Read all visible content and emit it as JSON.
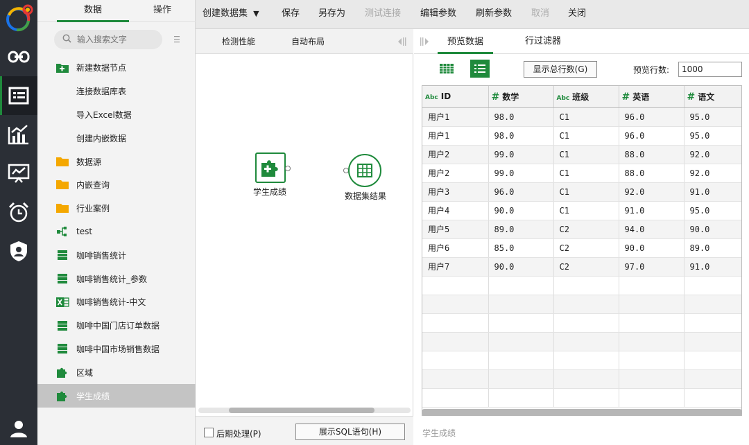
{
  "panel": {
    "tabs": [
      "数据",
      "操作"
    ],
    "search_placeholder": "输入搜索文字",
    "tree": [
      {
        "label": "新建数据节点",
        "icon": "new-folder-icon"
      },
      {
        "label": "连接数据库表",
        "icon": ""
      },
      {
        "label": "导入Excel数据",
        "icon": ""
      },
      {
        "label": "创建内嵌数据",
        "icon": ""
      },
      {
        "label": "数据源",
        "icon": "folder-icon"
      },
      {
        "label": "内嵌查询",
        "icon": "folder-icon"
      },
      {
        "label": "行业案例",
        "icon": "folder-icon"
      },
      {
        "label": "test",
        "icon": "flow-icon"
      },
      {
        "label": "咖啡销售统计",
        "icon": "table-icon"
      },
      {
        "label": "咖啡销售统计_参数",
        "icon": "table-icon"
      },
      {
        "label": "咖啡销售统计-中文",
        "icon": "excel-icon"
      },
      {
        "label": "咖啡中国门店订单数据",
        "icon": "table-icon"
      },
      {
        "label": "咖啡中国市场销售数据",
        "icon": "table-icon"
      },
      {
        "label": "区域",
        "icon": "puzzle-icon"
      },
      {
        "label": "学生成绩",
        "icon": "puzzle-icon",
        "selected": true
      }
    ]
  },
  "toolbar": {
    "create": "创建数据集",
    "save": "保存",
    "save_as": "另存为",
    "test_conn": "测试连接",
    "edit_params": "编辑参数",
    "refresh_params": "刷新参数",
    "cancel": "取消",
    "close": "关闭"
  },
  "canvas": {
    "detect": "检测性能",
    "auto_layout": "自动布局",
    "node_source": "学生成绩",
    "node_result": "数据集结果",
    "post_process": "后期处理(P)",
    "show_sql": "展示SQL语句(H)"
  },
  "preview": {
    "tab_preview": "预览数据",
    "tab_filter": "行过滤器",
    "show_total": "显示总行数(G)",
    "rows_label": "预览行数:",
    "rows_value": "1000",
    "footer": "学生成绩",
    "columns": [
      {
        "type": "Abc",
        "name": "ID"
      },
      {
        "type": "#",
        "name": "数学"
      },
      {
        "type": "Abc",
        "name": "班级"
      },
      {
        "type": "#",
        "name": "英语"
      },
      {
        "type": "#",
        "name": "语文"
      }
    ],
    "rows": [
      [
        "用户1",
        "98.0",
        "C1",
        "96.0",
        "95.0"
      ],
      [
        "用户1",
        "98.0",
        "C1",
        "96.0",
        "95.0"
      ],
      [
        "用户2",
        "99.0",
        "C1",
        "88.0",
        "92.0"
      ],
      [
        "用户2",
        "99.0",
        "C1",
        "88.0",
        "92.0"
      ],
      [
        "用户3",
        "96.0",
        "C1",
        "92.0",
        "91.0"
      ],
      [
        "用户4",
        "90.0",
        "C1",
        "91.0",
        "95.0"
      ],
      [
        "用户5",
        "89.0",
        "C2",
        "94.0",
        "90.0"
      ],
      [
        "用户6",
        "85.0",
        "C2",
        "90.0",
        "89.0"
      ],
      [
        "用户7",
        "90.0",
        "C2",
        "97.0",
        "91.0"
      ]
    ]
  }
}
